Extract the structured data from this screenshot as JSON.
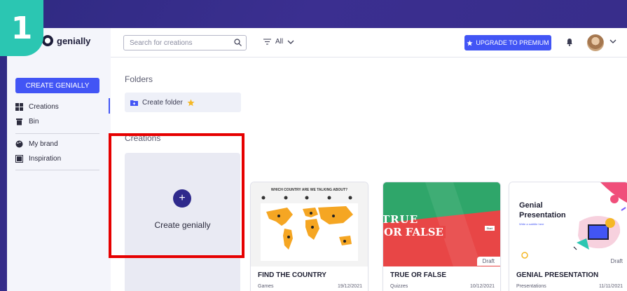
{
  "step_number": "1",
  "colors": {
    "accent": "#4255f5",
    "badge": "#2bc6b2",
    "highlight": "#e60000",
    "background": "#3a2e8c"
  },
  "logo": {
    "text": "genially"
  },
  "sidebar": {
    "create_button": "CREATE GENIALLY",
    "items": [
      {
        "label": "Creations",
        "icon": "grid-icon"
      },
      {
        "label": "Bin",
        "icon": "trash-icon"
      },
      {
        "label": "My brand",
        "icon": "palette-icon"
      },
      {
        "label": "Inspiration",
        "icon": "image-icon"
      }
    ]
  },
  "topbar": {
    "search_placeholder": "Search for creations",
    "filter_label": "All",
    "upgrade_label": "UPGRADE TO PREMIUM"
  },
  "folders": {
    "title": "Folders",
    "create_label": "Create folder"
  },
  "creations": {
    "title": "Creations",
    "new_label": "Create genially",
    "cards": [
      {
        "title": "FIND THE COUNTRY",
        "category": "Games",
        "date": "19/12/2021",
        "draft": ""
      },
      {
        "title": "TRUE OR FALSE",
        "category": "Quizzes",
        "date": "10/12/2021",
        "draft": "Draft"
      },
      {
        "title": "GENIAL PRESENTATION",
        "category": "Presentations",
        "date": "11/11/2021",
        "draft": "Draft"
      }
    ]
  },
  "thumbnails": {
    "map_heading": "WHICH COUNTRY ARE WE TALKING ABOUT?",
    "true_text": "TRUE",
    "false_text": "OR FALSE",
    "start_label": "Start",
    "presentation_title_1": "Genial",
    "presentation_title_2": "Presentation",
    "presentation_subtitle": "Write a subtitle here"
  }
}
